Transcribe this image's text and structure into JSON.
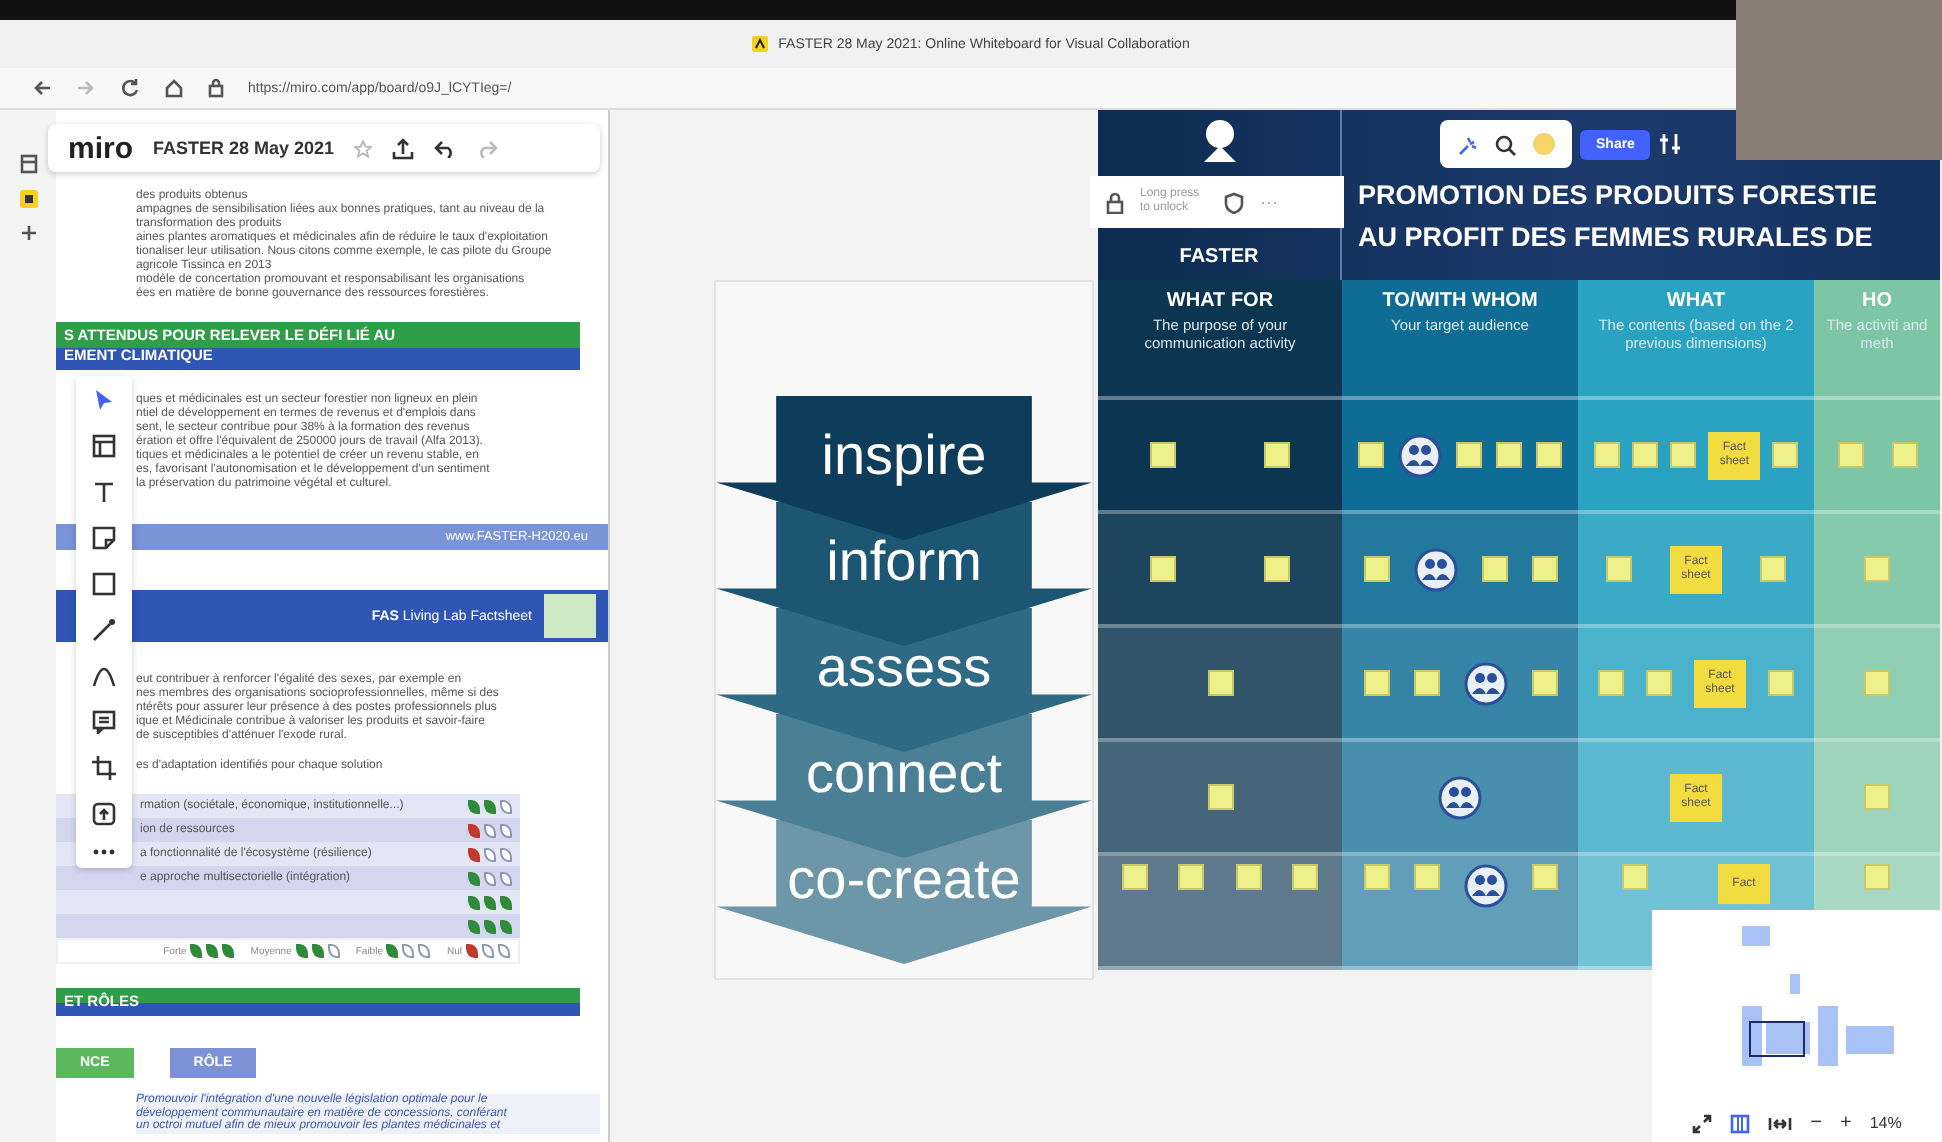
{
  "browser": {
    "tab_title": "FASTER 28 May 2021: Online Whiteboard for Visual Collaboration",
    "url": "https://miro.com/app/board/o9J_lCYTIeg=/"
  },
  "miro_toolbar": {
    "logo": "miro",
    "board_name": "FASTER 28 May 2021"
  },
  "share_button": "Share",
  "lock_popup": {
    "text": "Long press to unlock",
    "more": "···"
  },
  "document": {
    "blocks": [
      {
        "kind": "text",
        "lines": [
          "des produits obtenus",
          "ampagnes de sensibilisation liées aux bonnes pratiques, tant au niveau de la",
          "transformation des produits",
          "aines plantes aromatiques et médicinales afin de réduire le taux d'exploitation",
          "tionaliser leur utilisation. Nous citons comme exemple, le cas pilote du Groupe",
          "agricole Tissinca en 2013",
          "modèle de concertation promouvant et responsabilisant les organisations",
          "ées en matière de bonne gouvernance des ressources forestières."
        ]
      },
      {
        "kind": "banner",
        "lines": [
          "S ATTENDUS POUR RELEVER LE DÉFI LIÉ AU",
          "EMENT CLIMATIQUE"
        ]
      },
      {
        "kind": "text",
        "lines": [
          "ques et médicinales est un secteur forestier non ligneux en plein",
          "ntiel de développement en termes de revenus et d'emplois dans",
          "sent, le secteur contribue pour 38% à la formation des revenus",
          "ération et offre l'équivalent de 250000 jours de travail (Alfa 2013).",
          "tiques et médicinales a le potentiel de créer un revenu stable, en",
          "es, favorisant l'autonomisation et le développement d'un sentiment",
          "la préservation du patrimoine végétal et culturel."
        ]
      },
      {
        "kind": "band",
        "text": "www.FASTER-H2020.eu"
      },
      {
        "kind": "factsheet",
        "text": "**FAS** Living Lab Factsheet"
      },
      {
        "kind": "text",
        "lines": [
          "eut contribuer à renforcer l'égalité des sexes, par exemple en",
          "nes membres des organisations socioprofessionnelles, même si des",
          "ntérêts pour assurer leur présence à des postes professionnels plus",
          "ique et Médicinale contribue à valoriser les produits et savoir-faire",
          "de susceptibles d'atténuer l'exode rural."
        ]
      },
      {
        "kind": "text",
        "lines": [
          "es d'adaptation identifiés pour chaque solution"
        ]
      },
      {
        "kind": "table",
        "rows": [
          {
            "label": "rmation (sociétale, économique, institutionnelle...)",
            "stars": 2,
            "color": "#2e8b3a"
          },
          {
            "label": "ion de ressources",
            "stars": 1,
            "color": "#c0392b"
          },
          {
            "label": "a fonctionnalité de l'écosystème (résilience)",
            "stars": 1,
            "color": "#c0392b"
          },
          {
            "label": "e approche multisectorielle (intégration)",
            "stars": 1,
            "color": "#2e8b3a"
          },
          {
            "label": "",
            "stars": 3,
            "color": "#2e8b3a"
          },
          {
            "label": "",
            "stars": 3,
            "color": "#2e8b3a"
          }
        ],
        "legend": [
          {
            "label": "Forte",
            "stars": 3,
            "color": "#2e8b3a"
          },
          {
            "label": "Moyenne",
            "stars": 2,
            "color": "#2e8b3a"
          },
          {
            "label": "Faible",
            "stars": 1,
            "color": "#2e8b3a"
          },
          {
            "label": "Nul",
            "stars": 1,
            "color": "#c0392b"
          }
        ]
      },
      {
        "kind": "banner",
        "lines": [
          "ET RÔLES"
        ]
      },
      {
        "kind": "tags",
        "items": [
          {
            "label": "NCE",
            "color": "#5cb85c"
          },
          {
            "label": "RÔLE",
            "color": "#7b93d6"
          }
        ]
      },
      {
        "kind": "note",
        "lines": [
          "Promouvoir l'intégration d'une nouvelle législation optimale pour le",
          "développement communautaire en matière de concessions, conférant",
          "un octroi mutuel afin de mieux promouvoir les plantes médicinales et"
        ]
      }
    ]
  },
  "chevrons": [
    "inspire",
    "inform",
    "assess",
    "connect",
    "co-create"
  ],
  "board": {
    "logo": "FASTER",
    "title_lines": [
      "PROMOTION DES PRODUITS FORESTIE",
      "AU PROFIT DES FEMMES RURALES DE"
    ],
    "columns": [
      {
        "title": "WHAT FOR",
        "subtitle": "The purpose of your communication activity"
      },
      {
        "title": "TO/WITH WHOM",
        "subtitle": "Your target audience"
      },
      {
        "title": "WHAT",
        "subtitle": "The contents (based on the 2 previous dimensions)"
      },
      {
        "title": "HO",
        "subtitle": "The activiti and meth"
      }
    ],
    "rows": [
      {
        "cells": [
          [
            {
              "kind": "note"
            },
            {
              "kind": "note"
            }
          ],
          [
            {
              "kind": "note"
            },
            {
              "kind": "globe"
            },
            {
              "kind": "note"
            },
            {
              "kind": "note"
            },
            {
              "kind": "note"
            }
          ],
          [
            {
              "kind": "note"
            },
            {
              "kind": "note"
            },
            {
              "kind": "note"
            },
            {
              "kind": "fact",
              "text": "Fact sheet"
            },
            {
              "kind": "note"
            }
          ],
          [
            {
              "kind": "note"
            },
            {
              "kind": "note"
            }
          ]
        ]
      },
      {
        "cells": [
          [
            {
              "kind": "note"
            },
            {
              "kind": "note"
            }
          ],
          [
            {
              "kind": "note"
            },
            {
              "kind": "globe"
            },
            {
              "kind": "note"
            },
            {
              "kind": "note"
            }
          ],
          [
            {
              "kind": "note"
            },
            {
              "kind": "fact",
              "text": "Fact sheet"
            },
            {
              "kind": "note"
            }
          ],
          [
            {
              "kind": "note"
            }
          ]
        ]
      },
      {
        "cells": [
          [
            {
              "kind": "note"
            }
          ],
          [
            {
              "kind": "note"
            },
            {
              "kind": "note"
            },
            {
              "kind": "globe"
            },
            {
              "kind": "note"
            }
          ],
          [
            {
              "kind": "note"
            },
            {
              "kind": "note"
            },
            {
              "kind": "fact",
              "text": "Fact sheet"
            },
            {
              "kind": "note"
            }
          ],
          [
            {
              "kind": "note"
            }
          ]
        ]
      },
      {
        "cells": [
          [
            {
              "kind": "note"
            }
          ],
          [
            {
              "kind": "globe"
            }
          ],
          [
            {
              "kind": "fact",
              "text": "Fact sheet"
            }
          ],
          [
            {
              "kind": "note"
            }
          ]
        ]
      },
      {
        "cells": [
          [
            {
              "kind": "note"
            },
            {
              "kind": "note"
            },
            {
              "kind": "note"
            },
            {
              "kind": "note"
            }
          ],
          [
            {
              "kind": "note"
            },
            {
              "kind": "note"
            },
            {
              "kind": "globe"
            },
            {
              "kind": "note"
            }
          ],
          [
            {
              "kind": "note"
            },
            {
              "kind": "fact",
              "text": "Fact"
            }
          ],
          [
            {
              "kind": "note"
            }
          ]
        ]
      }
    ]
  },
  "minimap": {
    "zoom_out": "−",
    "zoom_in": "+",
    "zoom": "14%"
  }
}
